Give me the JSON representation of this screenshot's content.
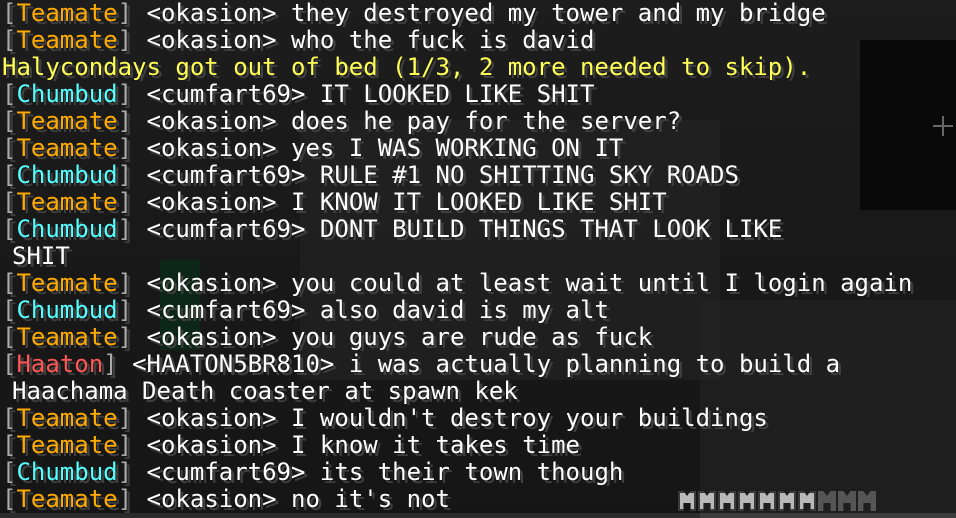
{
  "chat": {
    "lines": [
      {
        "rank": "Teamate",
        "rank_class": "teamate",
        "name": "<okasion>",
        "message": "they destroyed my tower and my bridge"
      },
      {
        "rank": "Teamate",
        "rank_class": "teamate",
        "name": "<okasion>",
        "message": "who the fuck is david"
      },
      {
        "system": "Halycondays got out of bed (1/3, 2 more needed to skip)."
      },
      {
        "rank": "Chumbud",
        "rank_class": "chumbud",
        "name": "<cumfart69>",
        "message": "IT LOOKED LIKE SHIT"
      },
      {
        "rank": "Teamate",
        "rank_class": "teamate",
        "name": "<okasion>",
        "message": "does he pay for the server?"
      },
      {
        "rank": "Teamate",
        "rank_class": "teamate",
        "name": "<okasion>",
        "message": "yes I WAS WORKING ON IT"
      },
      {
        "rank": "Chumbud",
        "rank_class": "chumbud",
        "name": "<cumfart69>",
        "message": "RULE #1 NO SHITTING SKY ROADS"
      },
      {
        "rank": "Teamate",
        "rank_class": "teamate",
        "name": "<okasion>",
        "message": "I KNOW IT LOOKED LIKE SHIT"
      },
      {
        "rank": "Chumbud",
        "rank_class": "chumbud",
        "name": "<cumfart69>",
        "message": "DONT BUILD THINGS THAT LOOK LIKE"
      },
      {
        "continuation": "SHIT"
      },
      {
        "rank": "Teamate",
        "rank_class": "teamate",
        "name": "<okasion>",
        "message": "you could at least wait until I login again"
      },
      {
        "rank": "Chumbud",
        "rank_class": "chumbud",
        "name": "<cumfart69>",
        "message": "also david is my alt"
      },
      {
        "rank": "Teamate",
        "rank_class": "teamate",
        "name": "<okasion>",
        "message": "you guys are rude as fuck"
      },
      {
        "rank": "Haaton",
        "rank_class": "haaton",
        "name": "<HAATON5BR810>",
        "message": "i was actually planning to build a"
      },
      {
        "continuation": "Haachama Death coaster at spawn kek"
      },
      {
        "rank": "Teamate",
        "rank_class": "teamate",
        "name": "<okasion>",
        "message": "I wouldn't destroy your buildings"
      },
      {
        "rank": "Teamate",
        "rank_class": "teamate",
        "name": "<okasion>",
        "message": "I know it takes time"
      },
      {
        "rank": "Chumbud",
        "rank_class": "chumbud",
        "name": "<cumfart69>",
        "message": "its their town though"
      },
      {
        "rank": "Teamate",
        "rank_class": "teamate",
        "name": "<okasion>",
        "message": "no it's not"
      }
    ]
  },
  "hud": {
    "armor_points_full": 7,
    "armor_points_total": 10,
    "crosshair_icon": "crosshair-icon",
    "armor_icon": "chestplate-icon"
  },
  "colors": {
    "teamate": "#ffaa00",
    "chumbud": "#55ffff",
    "haaton": "#ff5555",
    "system": "#ffff55",
    "bracket": "#aaaaaa",
    "text": "#ffffff"
  }
}
